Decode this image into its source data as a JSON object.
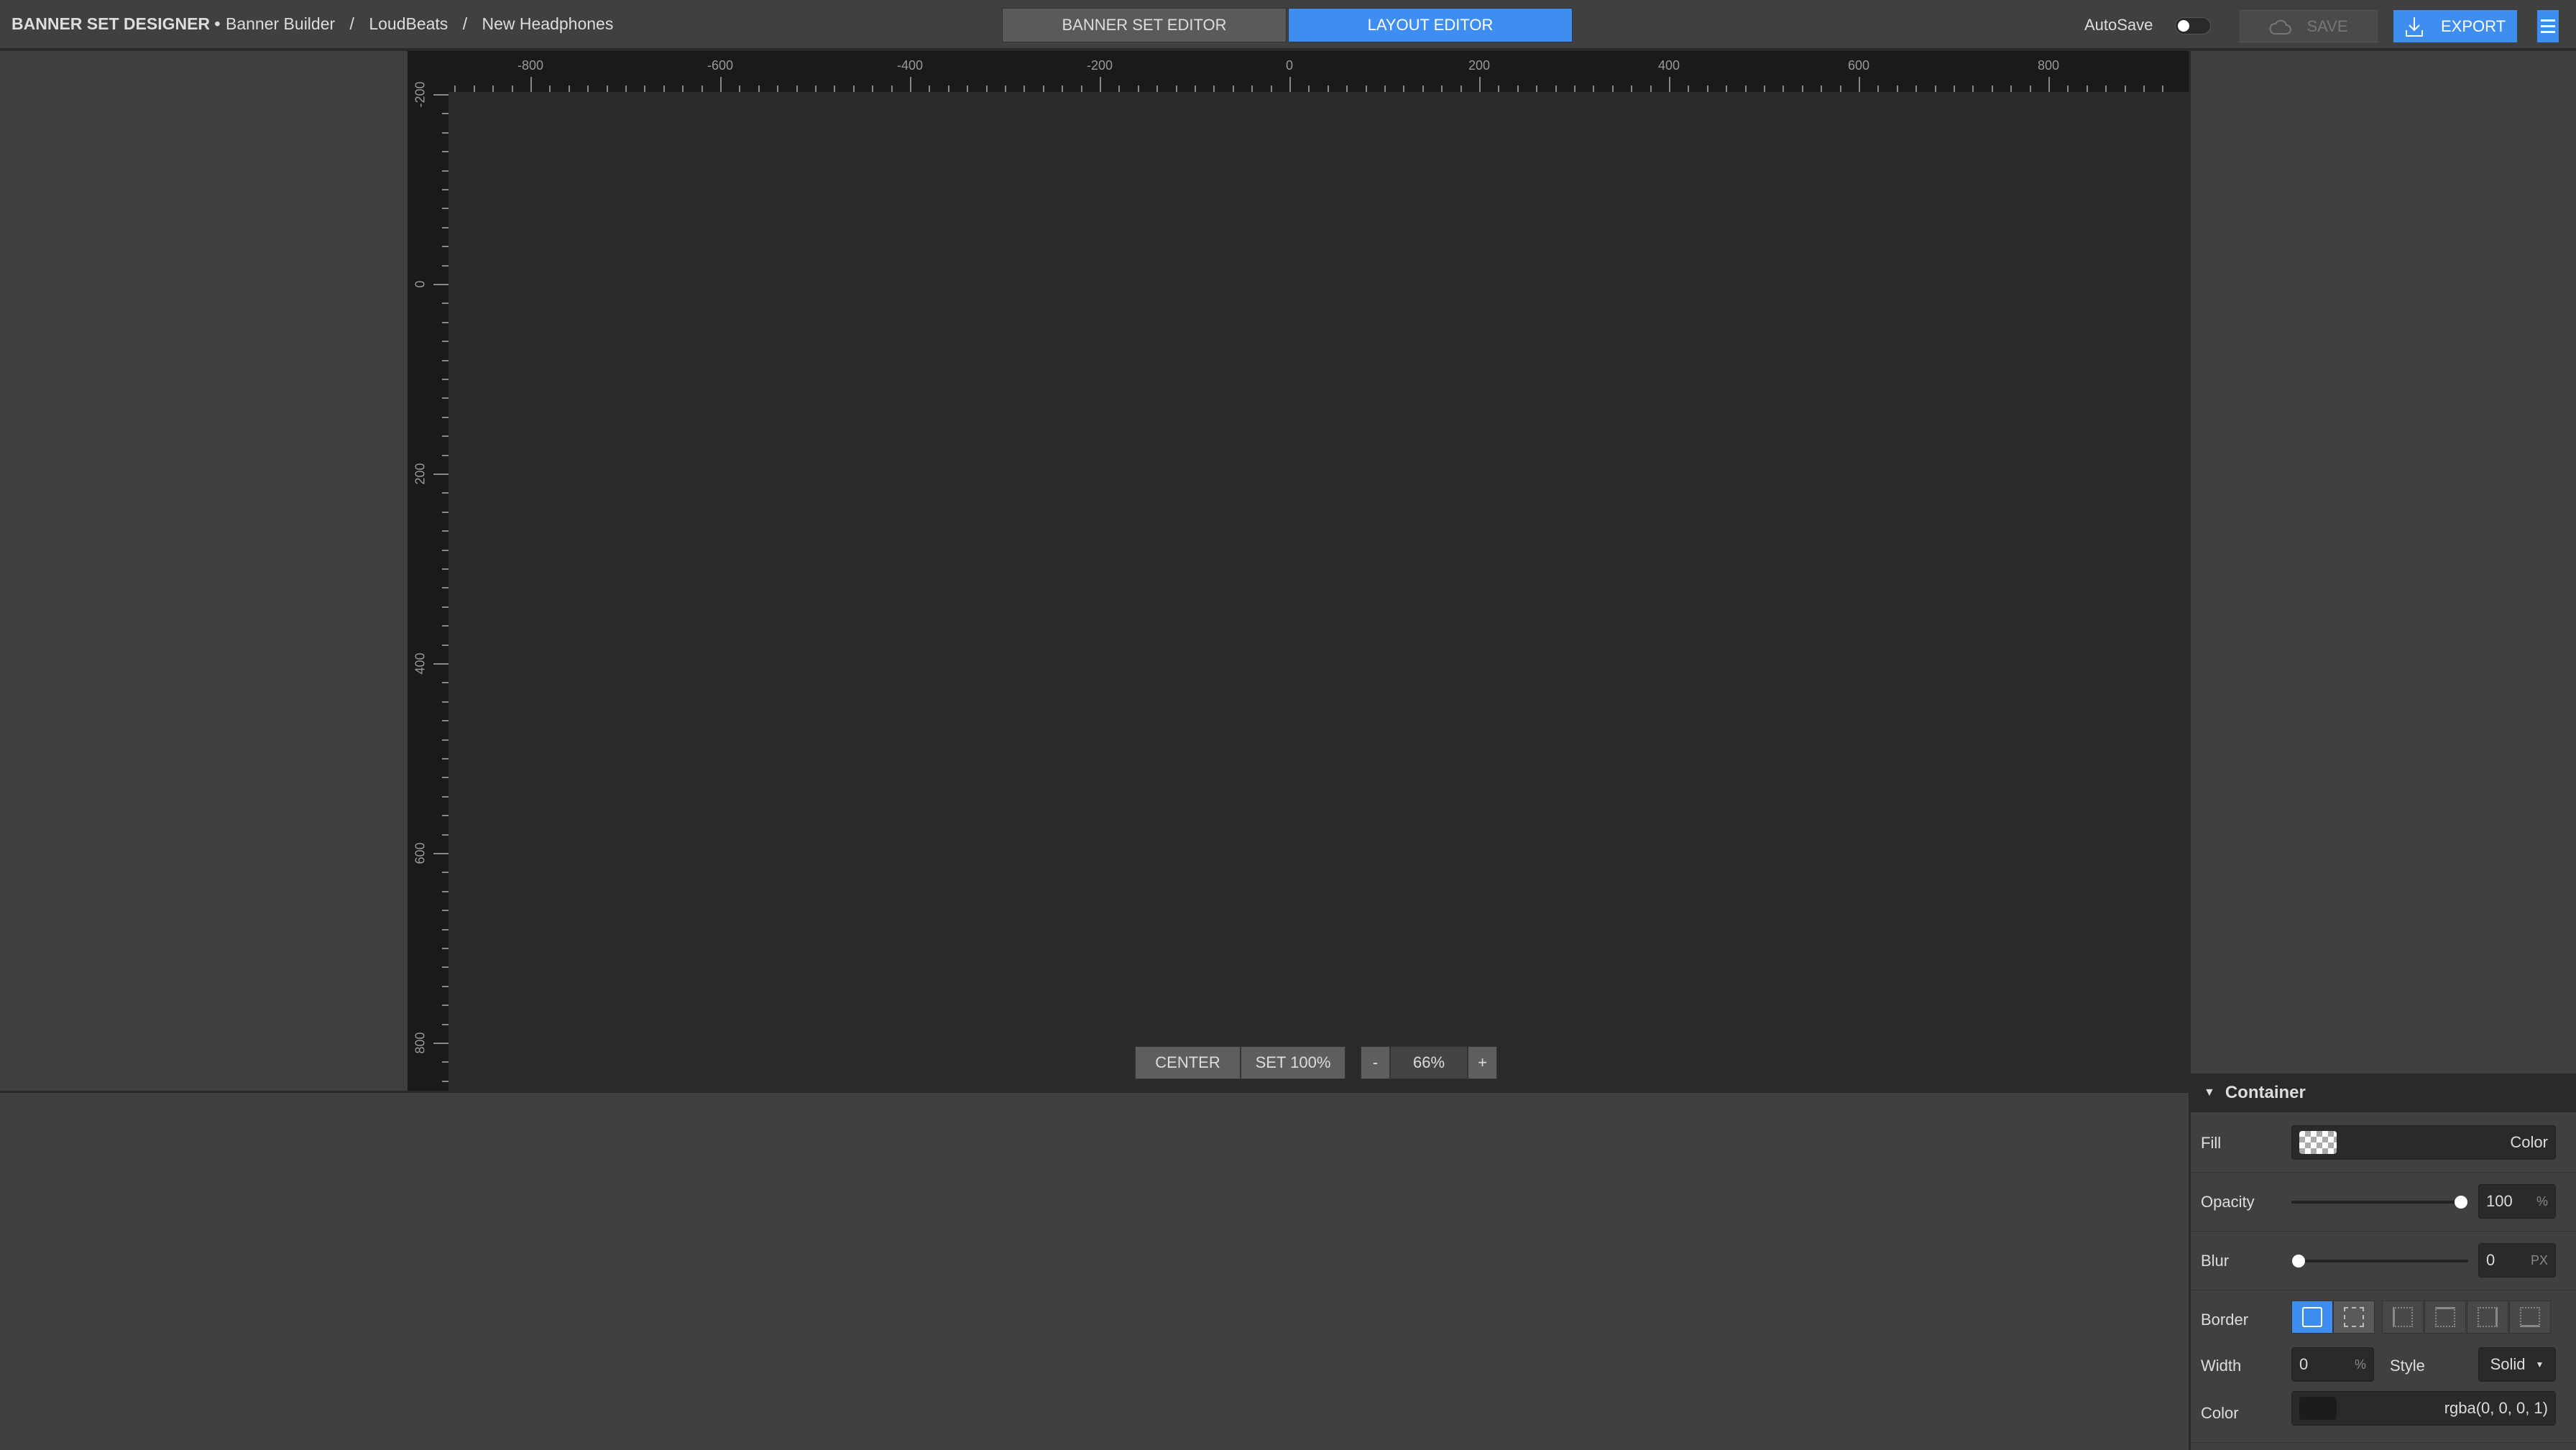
{
  "header": {
    "brand": "BANNER SET DESIGNER •",
    "breadcrumb": [
      "Banner Builder",
      "/",
      "LoudBeats",
      "/",
      "New Headphones"
    ],
    "tabs": [
      {
        "label": "BANNER SET EDITOR",
        "active": false
      },
      {
        "label": "LAYOUT EDITOR",
        "active": true
      }
    ],
    "autosave_label": "AutoSave",
    "autosave_on": false,
    "save_label": "SAVE",
    "export_label": "EXPORT"
  },
  "colors": {
    "accent": "#3d8ef0"
  },
  "ruler": {
    "horizontal": [
      -800,
      -600,
      -400,
      -200,
      0,
      200,
      400,
      600,
      800
    ],
    "vertical": [
      -200,
      0,
      200,
      400,
      600,
      800
    ]
  },
  "zoom": {
    "center_label": "CENTER",
    "set100_label": "SET 100%",
    "minus_label": "-",
    "value": "66%",
    "plus_label": "+"
  },
  "panel": {
    "section_title": "Container",
    "fill": {
      "label": "Fill",
      "value": "Color"
    },
    "opacity": {
      "label": "Opacity",
      "value": "100",
      "unit": "%",
      "level": 100
    },
    "blur": {
      "label": "Blur",
      "value": "0",
      "unit": "PX",
      "level": 0
    },
    "border": {
      "label": "Border"
    },
    "width": {
      "label": "Width",
      "value": "0",
      "unit": "%"
    },
    "style": {
      "label": "Style",
      "value": "Solid"
    },
    "color": {
      "label": "Color",
      "value": "rgba(0, 0, 0, 1)"
    }
  }
}
